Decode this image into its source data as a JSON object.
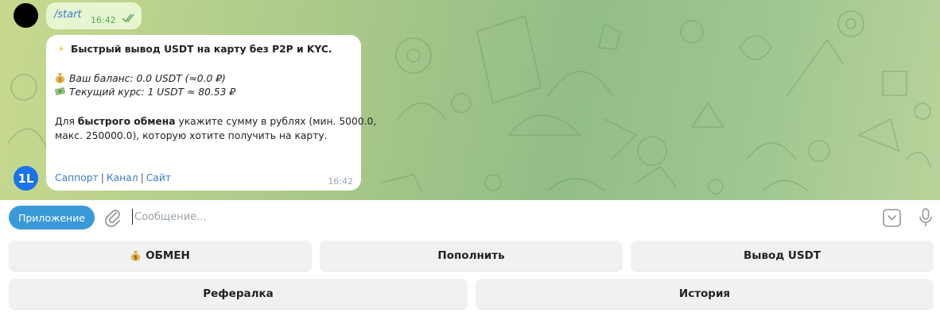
{
  "chat": {
    "outgoing": {
      "text": "/start",
      "time": "16:42"
    },
    "incoming": {
      "title": "Быстрый вывод USDT на карту без P2P и KYC.",
      "balance": "Ваш баланс: 0.0 USDT (≈0.0 ₽)",
      "rate": "Текущий курс: 1 USDT ≈ 80.53 ₽",
      "body_prefix": "Для ",
      "body_bold": "быстрого обмена",
      "body_rest": " укажите сумму в рублях (мин. 5000.0,",
      "body_line2": "макс. 250000.0), которую хотите получить на карту.",
      "links": [
        "Саппорт",
        "Канал",
        "Сайт"
      ],
      "separator": "|",
      "time": "16:42"
    },
    "bot_avatar_text": "1L"
  },
  "input_bar": {
    "app_button": "Приложение",
    "placeholder": "Сообщение..."
  },
  "keyboard": {
    "row1": [
      "ОБМЕН",
      "Пополнить",
      "Вывод USDT"
    ],
    "row2": [
      "Рефералка",
      "История"
    ]
  },
  "colors": {
    "accent": "#3a9ad9",
    "link": "#3a7bc8",
    "outgoing_bubble": "#e6f6d0",
    "bot_avatar": "#1a73e8"
  }
}
